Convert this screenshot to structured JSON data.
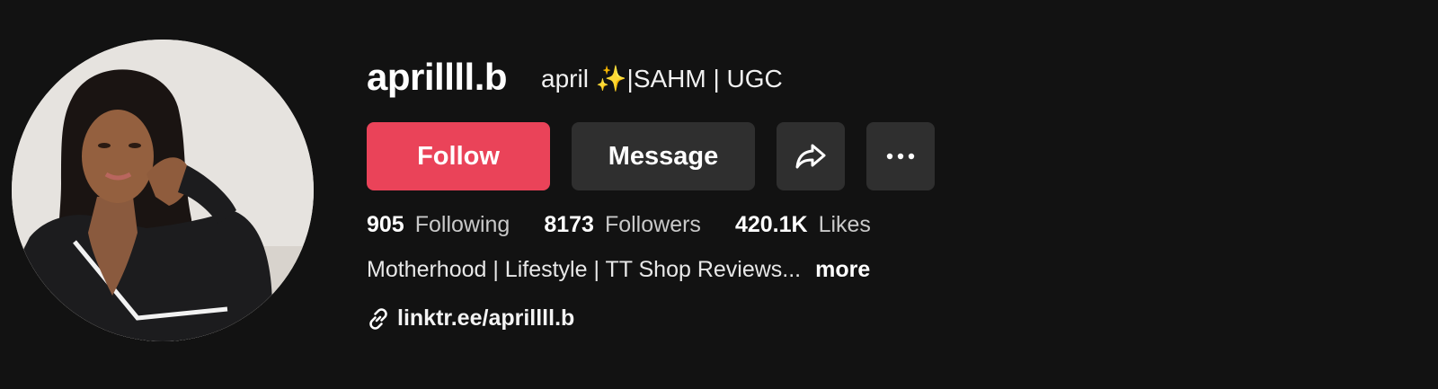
{
  "profile": {
    "username": "aprillll.b",
    "nickname": "april ✨|SAHM | UGC",
    "bio": "Motherhood | Lifestyle | TT Shop Reviews...",
    "bio_more_label": "more",
    "link_text": "linktr.ee/aprillll.b"
  },
  "actions": {
    "follow_label": "Follow",
    "message_label": "Message",
    "share_icon": "share-arrow-icon",
    "more_icon": "ellipsis-icon"
  },
  "stats": [
    {
      "value": "905",
      "label": "Following"
    },
    {
      "value": "8173",
      "label": "Followers"
    },
    {
      "value": "420.1K",
      "label": "Likes"
    }
  ],
  "colors": {
    "background": "#121212",
    "follow": "#ea4359",
    "secondary_button": "#2f2f2f"
  }
}
